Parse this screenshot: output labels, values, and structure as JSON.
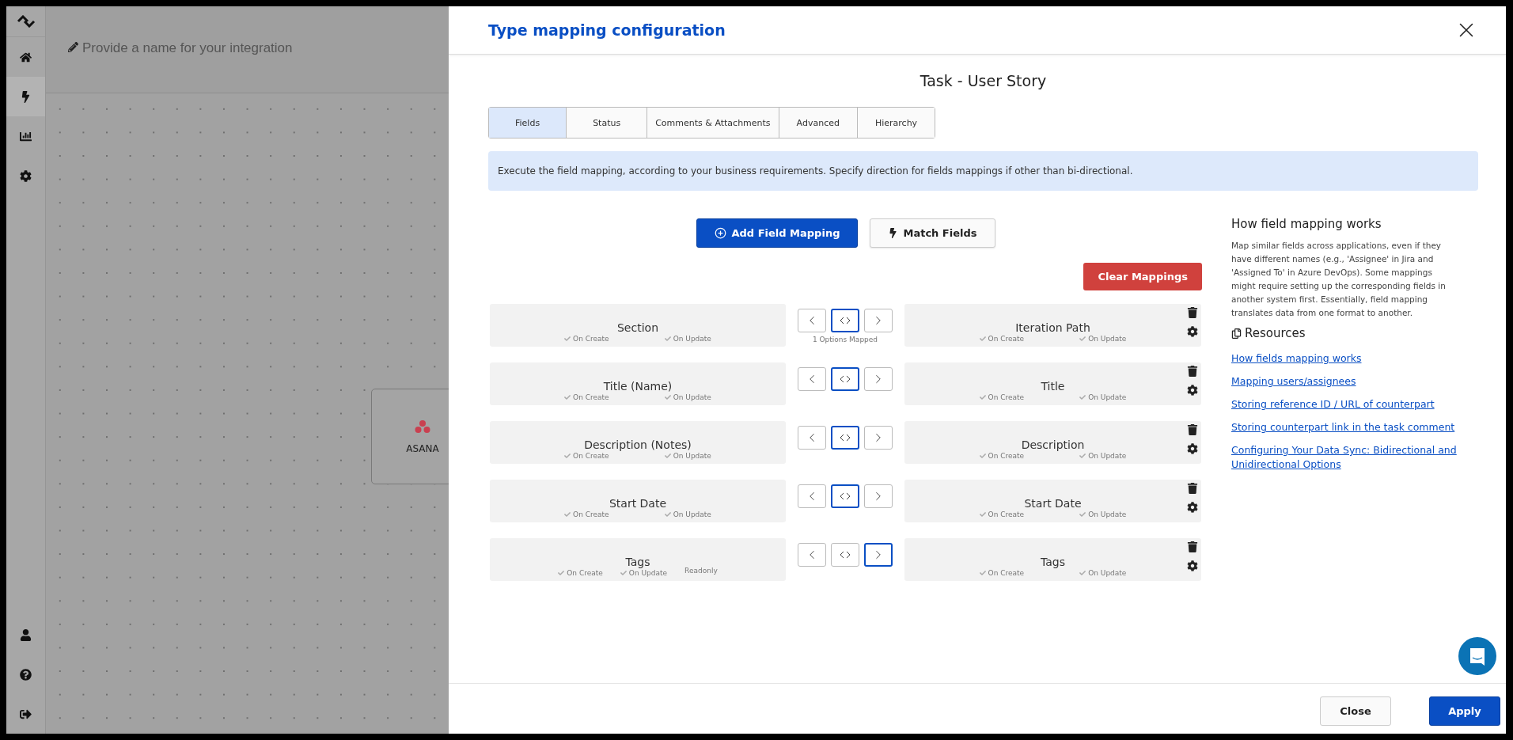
{
  "sidebar": {
    "items": [
      {
        "kind": "home",
        "selected": false
      },
      {
        "kind": "bolt",
        "selected": true
      },
      {
        "kind": "chart",
        "selected": false
      },
      {
        "kind": "settings",
        "selected": false
      }
    ],
    "bottom_items": [
      {
        "kind": "user"
      },
      {
        "kind": "help"
      },
      {
        "kind": "logout"
      }
    ]
  },
  "integration_name": {
    "placeholder": "Provide a name for your integration"
  },
  "canvas": {
    "nodes": [
      {
        "label": "ASANA"
      }
    ]
  },
  "modal": {
    "title": "Type mapping configuration",
    "subtitle": "Task - User Story",
    "tabs": [
      {
        "label": "Fields",
        "selected": true
      },
      {
        "label": "Status",
        "selected": false
      },
      {
        "label": "Comments & Attachments",
        "selected": false
      },
      {
        "label": "Advanced",
        "selected": false
      },
      {
        "label": "Hierarchy",
        "selected": false
      }
    ],
    "info": "Execute the field mapping, according to your business requirements. Specify direction for fields mappings if other than bi-directional.",
    "add_button": "Add Field Mapping",
    "match_button": "Match Fields",
    "clear_button": "Clear Mappings",
    "mappings": [
      {
        "left": {
          "name": "Section",
          "options": [
            {
              "label": "On Create",
              "checked": true
            },
            {
              "label": "On Update",
              "checked": true
            }
          ]
        },
        "directions": [
          {
            "kind": "left",
            "selected": false
          },
          {
            "kind": "both",
            "selected": true
          },
          {
            "kind": "right",
            "selected": false
          }
        ],
        "note": "1 Options Mapped",
        "right": {
          "name": "Iteration Path",
          "options": [
            {
              "label": "On Create",
              "checked": true
            },
            {
              "label": "On Update",
              "checked": true
            }
          ]
        }
      },
      {
        "left": {
          "name": "Title (Name)",
          "options": [
            {
              "label": "On Create",
              "checked": true
            },
            {
              "label": "On Update",
              "checked": true
            }
          ]
        },
        "directions": [
          {
            "kind": "left",
            "selected": false
          },
          {
            "kind": "both",
            "selected": true
          },
          {
            "kind": "right",
            "selected": false
          }
        ],
        "right": {
          "name": "Title",
          "options": [
            {
              "label": "On Create",
              "checked": true
            },
            {
              "label": "On Update",
              "checked": true
            }
          ]
        }
      },
      {
        "left": {
          "name": "Description (Notes)",
          "options": [
            {
              "label": "On Create",
              "checked": true
            },
            {
              "label": "On Update",
              "checked": true
            }
          ]
        },
        "directions": [
          {
            "kind": "left",
            "selected": false
          },
          {
            "kind": "both",
            "selected": true
          },
          {
            "kind": "right",
            "selected": false
          }
        ],
        "right": {
          "name": "Description",
          "options": [
            {
              "label": "On Create",
              "checked": true
            },
            {
              "label": "On Update",
              "checked": true
            }
          ]
        }
      },
      {
        "left": {
          "name": "Start Date",
          "options": [
            {
              "label": "On Create",
              "checked": true
            },
            {
              "label": "On Update",
              "checked": true
            }
          ]
        },
        "directions": [
          {
            "kind": "left",
            "selected": false
          },
          {
            "kind": "both",
            "selected": true
          },
          {
            "kind": "right",
            "selected": false
          }
        ],
        "right": {
          "name": "Start Date",
          "options": [
            {
              "label": "On Create",
              "checked": true
            },
            {
              "label": "On Update",
              "checked": true
            }
          ]
        }
      },
      {
        "left": {
          "name": "Tags",
          "options": [
            {
              "label": "On Create",
              "checked": true
            },
            {
              "label": "On Update",
              "checked": true
            }
          ],
          "readonly": "Readonly"
        },
        "directions": [
          {
            "kind": "left",
            "selected": false
          },
          {
            "kind": "both",
            "selected": false
          },
          {
            "kind": "right",
            "selected": true
          }
        ],
        "right": {
          "name": "Tags",
          "options": [
            {
              "label": "On Create",
              "checked": true
            },
            {
              "label": "On Update",
              "checked": true
            }
          ]
        }
      }
    ],
    "help": {
      "title": "How field mapping works",
      "text": "Map similar fields across applications, even if they have different names (e.g., 'Assignee' in Jira and 'Assigned To' in Azure DevOps). Some mappings might require setting up the corresponding fields in another system first. Essentially, field mapping translates data from one format to another.",
      "resources_title": "Resources",
      "links": [
        "How fields mapping works",
        "Mapping users/assignees",
        "Storing reference ID / URL of counterpart",
        "Storing counterpart link in the task comment",
        "Configuring Your Data Sync: Bidirectional and Unidirectional Options"
      ]
    },
    "close_button": "Close",
    "apply_button": "Apply"
  }
}
